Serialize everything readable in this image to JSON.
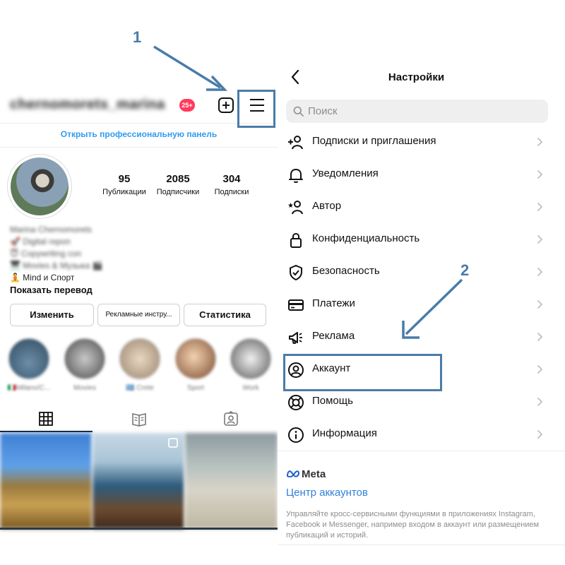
{
  "profile": {
    "username": "chernomorets_marina",
    "live_badge": "25+",
    "pro_dashboard_link": "Открыть профессиональную панель",
    "stats": [
      {
        "value": "95",
        "label": "Публикации"
      },
      {
        "value": "2085",
        "label": "Подписчики"
      },
      {
        "value": "304",
        "label": "Подписки"
      }
    ],
    "bio": {
      "name": "Marina Chernomorets",
      "line1": "🚀 Digital героп",
      "line2": "😇 Copywriting con",
      "line3": "🎹 Movies & Музыка 🎬",
      "line4": "🧘 Mind и Спорт"
    },
    "show_translation": "Показать перевод",
    "buttons": {
      "edit": "Изменить",
      "ads_tools": "Рекламные инстру...",
      "statistics": "Статистика"
    },
    "highlights": [
      "🇮🇹Milano/C...",
      "Movies",
      "🇬🇷 Crete",
      "Sport",
      "Work"
    ],
    "tabs": [
      "grid",
      "guides",
      "tagged"
    ]
  },
  "settings": {
    "title": "Настройки",
    "search_placeholder": "Поиск",
    "items": [
      {
        "label": "Подписки и приглашения",
        "icon": "add-person-icon"
      },
      {
        "label": "Уведомления",
        "icon": "bell-icon"
      },
      {
        "label": "Автор",
        "icon": "star-person-icon"
      },
      {
        "label": "Конфиденциальность",
        "icon": "lock-icon"
      },
      {
        "label": "Безопасность",
        "icon": "shield-check-icon"
      },
      {
        "label": "Платежи",
        "icon": "card-icon"
      },
      {
        "label": "Реклама",
        "icon": "megaphone-icon"
      },
      {
        "label": "Аккаунт",
        "icon": "account-circle-icon"
      },
      {
        "label": "Помощь",
        "icon": "lifebuoy-icon"
      },
      {
        "label": "Информация",
        "icon": "info-icon"
      }
    ],
    "meta": {
      "logo_text": "Meta",
      "accounts_center": "Центр аккаунтов",
      "description": "Управляйте кросс-сервисными функциями в приложениях Instagram, Facebook и Messenger, например входом в аккаунт или размещением публикаций и историй."
    }
  },
  "annotations": {
    "step1": "1",
    "step2": "2",
    "color": "#4a7ca8"
  },
  "colors": {
    "link_blue": "#2f9cf0",
    "accounts_blue": "#2f80d8",
    "badge_red": "#ff3b5c"
  }
}
